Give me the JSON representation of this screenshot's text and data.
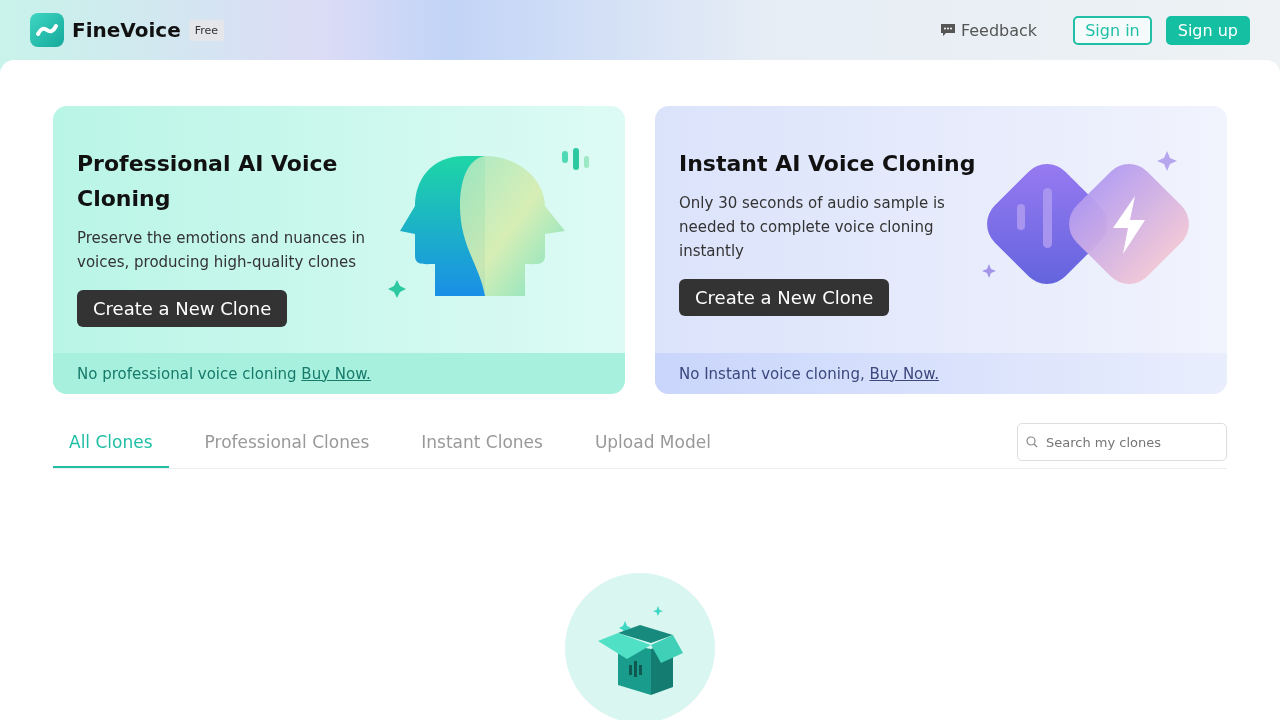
{
  "header": {
    "brand": "FineVoice",
    "plan_badge": "Free",
    "feedback": "Feedback",
    "sign_in": "Sign in",
    "sign_up": "Sign up"
  },
  "cards": [
    {
      "kind": "professional",
      "title": "Professional AI Voice Cloning",
      "description": "Preserve the emotions and nuances in voices, producing high-quality clones",
      "button": "Create a New Clone",
      "footer_text": "No professional voice cloning ",
      "footer_link": "Buy Now."
    },
    {
      "kind": "instant",
      "title": "Instant AI Voice Cloning",
      "description": "Only 30 seconds of audio sample is needed to complete voice cloning instantly",
      "button": "Create a New Clone",
      "footer_text": "No Instant voice cloning, ",
      "footer_link": "Buy Now."
    }
  ],
  "tabs": [
    {
      "label": "All Clones",
      "selected": true
    },
    {
      "label": "Professional Clones",
      "selected": false
    },
    {
      "label": "Instant Clones",
      "selected": false
    },
    {
      "label": "Upload Model",
      "selected": false
    }
  ],
  "search": {
    "placeholder": "Search my clones"
  }
}
